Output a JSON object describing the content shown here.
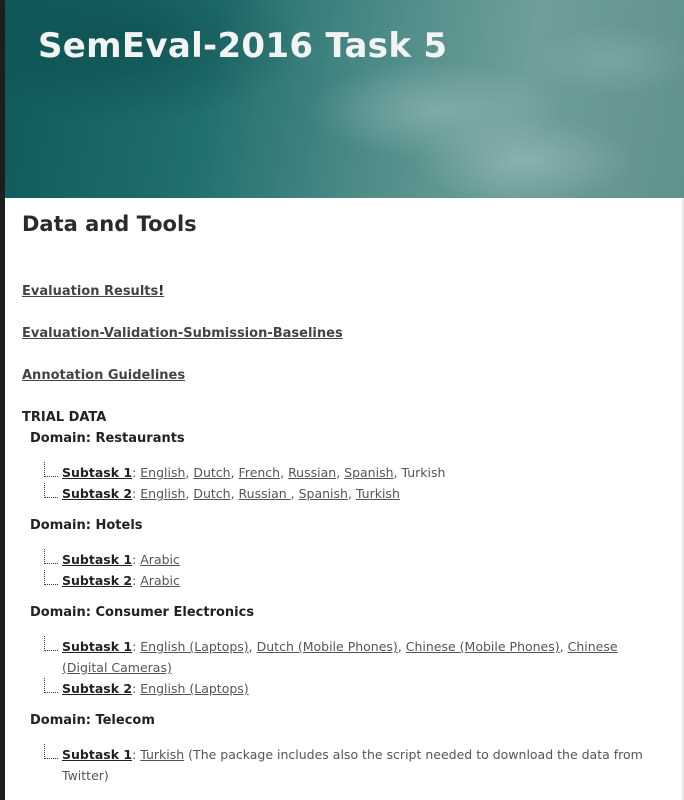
{
  "site": {
    "title": "SemEval-2016 Task 5"
  },
  "page": {
    "title": "Data and Tools"
  },
  "links": {
    "evaluation_results": "Evaluation Results",
    "evaluation_results_suffix": "!",
    "evaluation_validation": "Evaluation-Validation-Submission-Baselines",
    "annotation_guidelines": "Annotation Guidelines"
  },
  "trial": {
    "heading": "TRIAL DATA",
    "domains": [
      {
        "name": "Domain: Restaurants",
        "subtasks": [
          {
            "label": "Subtask 1",
            "items": [
              "English",
              "Dutch",
              "French",
              "Russian",
              "Spanish",
              "Turkish"
            ]
          },
          {
            "label": "Subtask 2",
            "items": [
              "English",
              "Dutch",
              "Russian ",
              "Spanish",
              "Turkish"
            ]
          }
        ]
      },
      {
        "name": "Domain: Hotels",
        "subtasks": [
          {
            "label": "Subtask 1",
            "items": [
              "Arabic"
            ]
          },
          {
            "label": "Subtask 2",
            "items": [
              "Arabic"
            ]
          }
        ]
      },
      {
        "name": "Domain: Consumer Electronics",
        "subtasks": [
          {
            "label": "Subtask 1",
            "items": [
              "English (Laptops)",
              "Dutch (Mobile Phones)",
              "Chinese (Mobile Phones)",
              "Chinese (Digital Cameras)"
            ]
          },
          {
            "label": "Subtask 2",
            "items": [
              "English (Laptops)"
            ]
          }
        ]
      },
      {
        "name": "Domain: Telecom",
        "subtasks": [
          {
            "label": "Subtask 1",
            "items": [
              "Turkish"
            ],
            "note": " (The package includes also the script needed to download the data from Twitter)"
          }
        ]
      }
    ]
  }
}
